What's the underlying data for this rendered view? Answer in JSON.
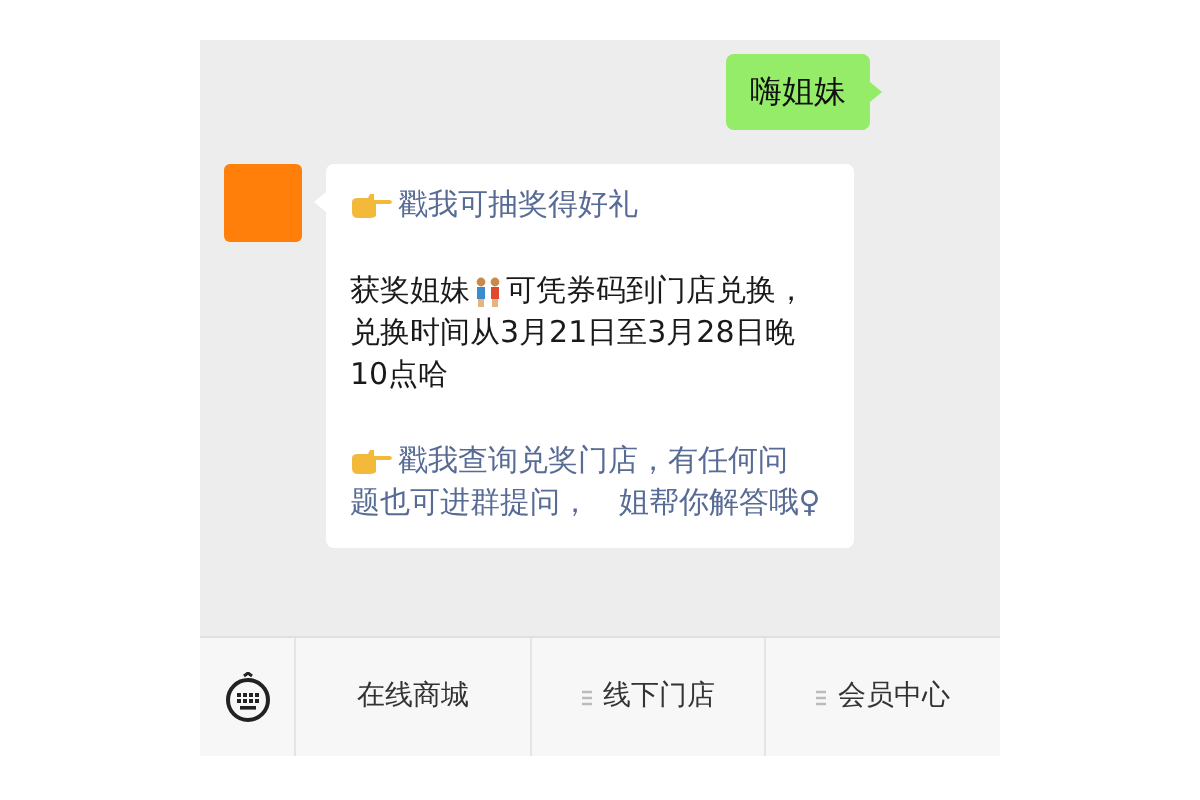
{
  "messages": [
    {
      "kind": "outgoing",
      "text": "嗨姐妹"
    },
    {
      "kind": "incoming",
      "blocks": [
        {
          "kind": "link",
          "lines": [
            "戳我可抽奖得好礼"
          ]
        },
        {
          "kind": "text",
          "before": "获奖姐妹",
          "after": "可凭券码到门店兑换，",
          "rest": "兑换时间从3月21日至3月28日晚10点哈"
        },
        {
          "kind": "link",
          "lines": [
            "戳我查询兑奖门店，有任何问",
            "题也可进群提问，   姐帮你解答哦♀"
          ]
        }
      ]
    }
  ],
  "menu": {
    "items": [
      {
        "label": "在线商城",
        "has_submenu": false
      },
      {
        "label": "线下门店",
        "has_submenu": true
      },
      {
        "label": "会员中心",
        "has_submenu": true
      }
    ]
  }
}
